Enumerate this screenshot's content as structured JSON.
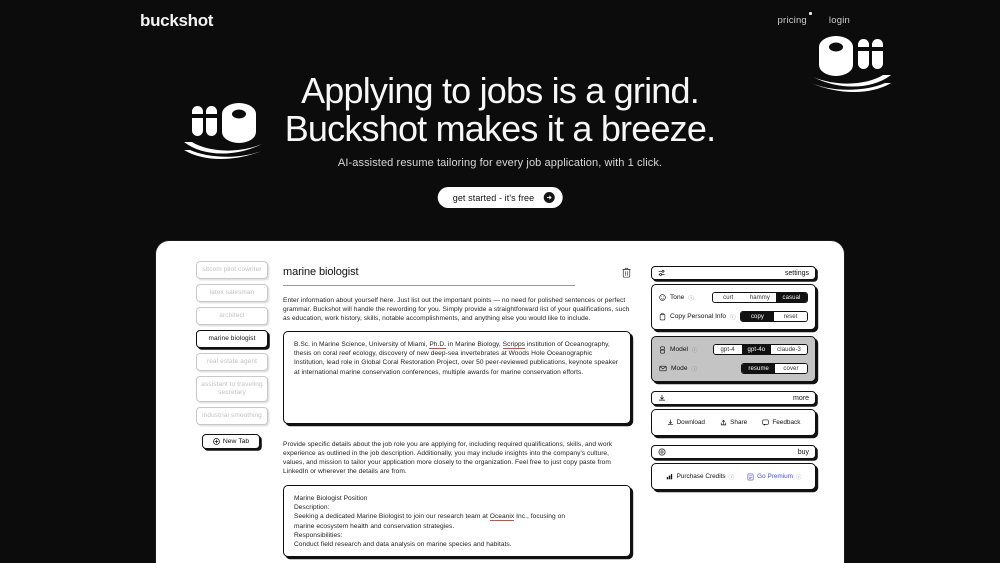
{
  "brand": {
    "name": "buckshot"
  },
  "nav": {
    "pricing": "pricing",
    "login": "login"
  },
  "hero": {
    "title_line1": "Applying to jobs is a grind.",
    "title_line2": "Buckshot makes it a breeze.",
    "subtitle": "AI-assisted resume tailoring for every job application, with 1 click.",
    "cta_label": "get started - it's free"
  },
  "app": {
    "sidebar": {
      "tabs": [
        {
          "label": "sitcom pilot cowriter",
          "active": false
        },
        {
          "label": "latex salesman",
          "active": false
        },
        {
          "label": "architect",
          "active": false
        },
        {
          "label": "marine biologist",
          "active": true
        },
        {
          "label": "real estate agent",
          "active": false
        },
        {
          "label": "assistant to traveling secretary",
          "active": false
        },
        {
          "label": "industrial smoothing",
          "active": false
        }
      ],
      "new_tab_label": "New Tab"
    },
    "main": {
      "doc_title": "marine biologist",
      "helper_resume": "Enter information about yourself here. Just list out the important points — no need for polished sentences or perfect grammar. Buckshot will handle the rewording for you. Simply provide a straightforward list of your qualifications, such as education, work history, skills, notable accomplishments, and anything else you would like to include.",
      "resume_text": "B.Sc. in Marine Science, University of Miami, Ph.D. in Marine Biology, Scripps institution of Oceanography, thesis on coral reef ecology, discovery of new deep-sea invertebrates at Woods Hole Oceanographic Institution, lead role in Global Coral Restoration Project, over 50 peer-reviewed publications, keynote speaker at international marine conservation conferences, multiple awards for marine conservation efforts.",
      "helper_job": "Provide specific details about the job role you are applying for, including required qualifications, skills, and work experience as outlined in the job description. Additionally, you may include insights into the company's culture, values, and mission to tailor your application more closely to the organization. Feel free to just copy paste from LinkedIn or wherever the details are from.",
      "job_text_lines": [
        "Marine Biologist Position",
        "Description:",
        "Seeking a dedicated Marine Biologist to join our research team at Oceanix Inc., focusing on",
        "marine ecosystem health and conservation strategies.",
        "Responsibilities:",
        "Conduct field research and data analysis on marine species and habitats."
      ]
    },
    "settings": {
      "header_label": "settings",
      "rows": [
        {
          "label": "Tone",
          "info": "ⓘ",
          "options": [
            "curt",
            "hammy",
            "casual"
          ],
          "selected": "casual"
        },
        {
          "label": "Copy Personal Info",
          "info": "ⓘ",
          "options": [
            "copy",
            "reset"
          ],
          "selected": "copy"
        }
      ],
      "rows_disabled": [
        {
          "label": "Model",
          "info": "ⓘ",
          "options": [
            "gpt-4",
            "gpt-4o",
            "claude-3"
          ],
          "selected": "gpt-4o"
        },
        {
          "label": "Mode",
          "info": "ⓘ",
          "options": [
            "resume",
            "cover"
          ],
          "selected": "resume"
        }
      ]
    },
    "more": {
      "header_label": "more",
      "actions": [
        "Download",
        "Share",
        "Feedback"
      ]
    },
    "buy": {
      "header_label": "buy",
      "purchase_credits": "Purchase Credits",
      "go_premium": "Go Premium",
      "info": "ⓘ"
    }
  },
  "colors": {
    "hero_bg": "#0c0c0c",
    "accent_premium": "#4a4fd6",
    "spellcheck": "#e0483c",
    "ink": "#111111"
  }
}
